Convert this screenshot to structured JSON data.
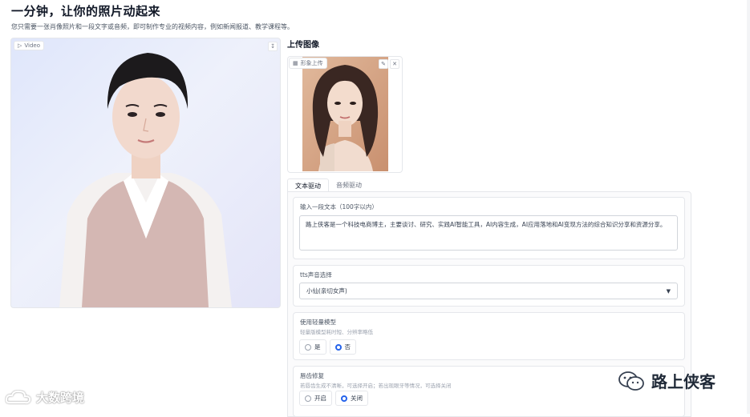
{
  "header": {
    "title": "一分钟，让你的照片动起来",
    "subtitle": "您只需要一张肖像照片和一段文字或音频，即可制作专业的视频内容，例如新闻报道、教学课程等。"
  },
  "video": {
    "tag_label": "Video",
    "download_icon": "download-icon"
  },
  "upload": {
    "label": "上传图像",
    "image_tag": "形象上传",
    "tools": [
      "edit-icon",
      "close-icon"
    ]
  },
  "tabs": [
    {
      "label": "文本驱动",
      "active": true
    },
    {
      "label": "音频驱动",
      "active": false
    }
  ],
  "text_input": {
    "label": "输入一段文本（100字以内）",
    "value": "路上侠客是一个科技电商博主，主要谈讨、研究、实践AI智能工具，AI内容生成，AI应用落地和AI变现方法的综合知识分享和资源分享。"
  },
  "tts": {
    "label": "tts声音选择",
    "selected": "小仙(亲切女声)"
  },
  "light_model": {
    "label": "使用轻量模型",
    "hint": "轻量版模型耗时短、分辨率略低",
    "options": [
      "是",
      "否"
    ],
    "selected_index": 1
  },
  "lip_fix": {
    "label": "唇齿修复",
    "hint": "若唇齿生成不清晰，可选择开启；若出现眼牙等情况，可选择关闭",
    "options": [
      "开启",
      "关闭"
    ],
    "selected_index": 1
  },
  "watermarks": {
    "right": "路上侠客",
    "left": "大数跨境"
  }
}
